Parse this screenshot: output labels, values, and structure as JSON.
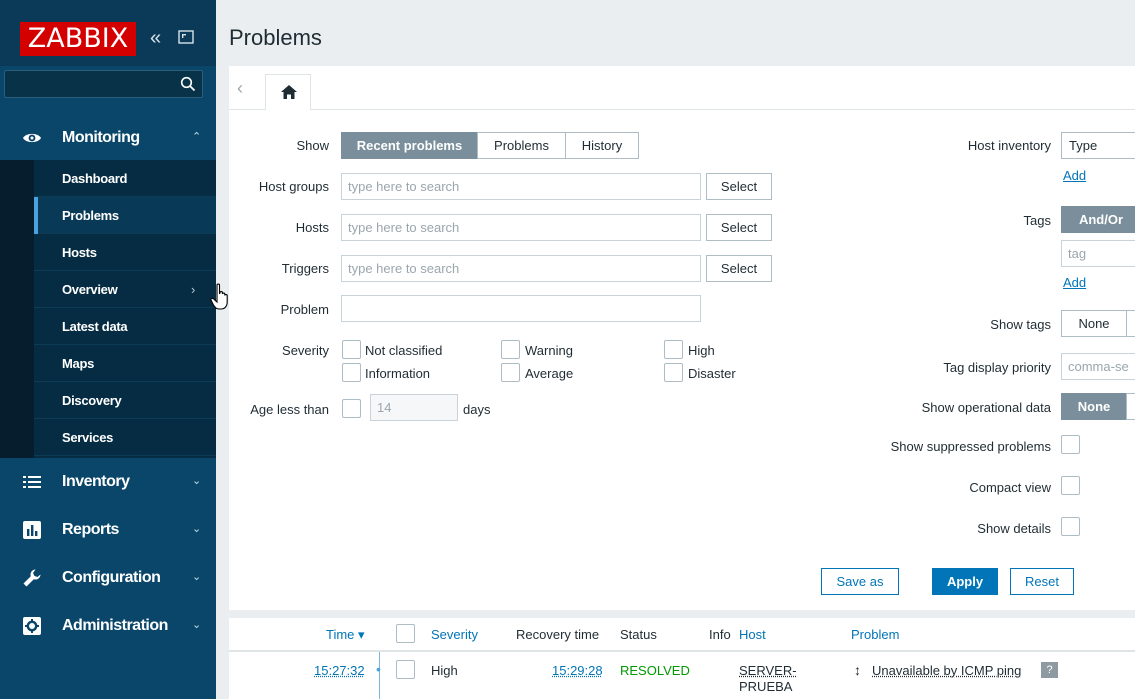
{
  "sidebar": {
    "logo": "ZABBIX",
    "collapse_glyph": "«",
    "search": {
      "value": "",
      "placeholder": ""
    },
    "sections": {
      "monitoring": "Monitoring",
      "inventory": "Inventory",
      "reports": "Reports",
      "configuration": "Configuration",
      "administration": "Administration"
    },
    "monitoring_items": {
      "dashboard": "Dashboard",
      "problems": "Problems",
      "hosts": "Hosts",
      "overview": "Overview",
      "latest_data": "Latest data",
      "maps": "Maps",
      "discovery": "Discovery",
      "services": "Services"
    },
    "chevron_up": "⌃",
    "chevron_down": "⌄",
    "overview_arrow": "›"
  },
  "page": {
    "title": "Problems"
  },
  "tabs": {
    "prev_glyph": "‹"
  },
  "filter": {
    "show_label": "Show",
    "show_options": {
      "recent": "Recent problems",
      "problems": "Problems",
      "history": "History"
    },
    "host_groups_label": "Host groups",
    "hosts_label": "Hosts",
    "triggers_label": "Triggers",
    "problem_label": "Problem",
    "search_placeholder": "type here to search",
    "problem_value": "",
    "select_label": "Select",
    "severity_label": "Severity",
    "severities": {
      "not_classified": "Not classified",
      "information": "Information",
      "warning": "Warning",
      "average": "Average",
      "high": "High",
      "disaster": "Disaster"
    },
    "age_label": "Age less than",
    "age_value": "14",
    "age_unit": "days",
    "host_inventory_label": "Host inventory",
    "host_inventory_type": "Type",
    "add_label": "Add",
    "tags_label": "Tags",
    "tags_mode": "And/Or",
    "tag_placeholder": "tag",
    "show_tags_label": "Show tags",
    "show_tags_value": "None",
    "tag_priority_label": "Tag display priority",
    "tag_priority_placeholder": "comma-se",
    "operational_label": "Show operational data",
    "operational_value": "None",
    "suppressed_label": "Show suppressed problems",
    "compact_label": "Compact view",
    "details_label": "Show details",
    "save_as": "Save as",
    "apply": "Apply",
    "reset": "Reset"
  },
  "table": {
    "headers": {
      "time": "Time ▾",
      "severity": "Severity",
      "recovery_time": "Recovery time",
      "status": "Status",
      "info": "Info",
      "host": "Host",
      "problem": "Problem"
    },
    "rows": [
      {
        "time": "15:27:32",
        "severity": "High",
        "recovery_time": "15:29:28",
        "status": "RESOLVED",
        "host_line1": "SERVER-",
        "host_line2": "PRUEBA",
        "problem": "Unavailable by ICMP ping",
        "info_badge": "?"
      }
    ]
  },
  "colors": {
    "sidebar_bg": "#0a466a",
    "logo_red": "#d40000",
    "link_blue": "#0275b8",
    "resolved_green": "#009900",
    "high_severity": "#ff9999"
  },
  "icons": {
    "monitoring": "eye-icon",
    "inventory": "list-icon",
    "reports": "bar-chart-icon",
    "configuration": "wrench-icon",
    "administration": "gear-box-icon",
    "search": "search-icon",
    "home": "home-icon"
  }
}
